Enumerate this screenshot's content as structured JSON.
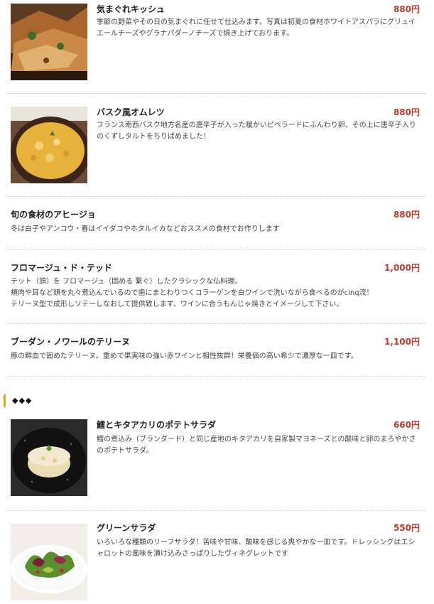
{
  "section_marker": "◆◆◆",
  "items": [
    {
      "name": "気まぐれキッシュ",
      "price": "880円",
      "description": "季節の野菜やその日の気まぐれに任せて仕込みます。写真は初夏の食材ホワイトアスパラにグリュイエールチーズやグラナパダーノチーズで焼き上げております。"
    },
    {
      "name": "バスク風オムレツ",
      "price": "880円",
      "description": "フランス南西バスク地方名産の唐辛子が入った暖かいピペラードにふんわり卵、その上に唐辛子入りのくずしタルトをちりばめました！"
    },
    {
      "name": "旬の食材のアヒージョ",
      "price": "880円",
      "description": "冬は白子やアンコウ・春はイイダコやホタルイカなどおススメの食材でお作りします"
    },
    {
      "name": "フロマージュ・ド・テッド",
      "price": "1,000円",
      "description_lines": [
        "テット（頭）を フロマージュ（固める 繋ぐ）したクラシックな仏料理。",
        "頬肉や耳など頭を丸々煮込んでいるので歯にまとわりつくコラーゲンを白ワインで洗いながら食べるのがcinq流！",
        "テリーヌ型で成形しソテーしなおして提供致します、ワインに合うもんじゃ焼きとイメージして下さい。"
      ]
    },
    {
      "name": "ブーダン・ノワールのテリーヌ",
      "price": "1,100円",
      "description": "豚の鮮血で固めたテリーヌ。重めで果実味の強い赤ワインと相性抜群！栄養価の高い希少で濃厚な一皿です。"
    },
    {
      "name": "鱈とキタアカリのポテトサラダ",
      "price": "660円",
      "description": "鱈の煮込み（ブランダード）と同じ産地のキタアカリを自家製マヨネーズとの酸味と卵のまろやかさのポテトサラダ。"
    },
    {
      "name": "グリーンサラダ",
      "price": "550円",
      "description": "いろいろな種類のリーフサラダ！苦味や甘味、酸味を感じる爽やかな一皿です。ドレッシングはエシャロットの風味を漬け込みさっぱりしたヴィネグレットです"
    }
  ]
}
